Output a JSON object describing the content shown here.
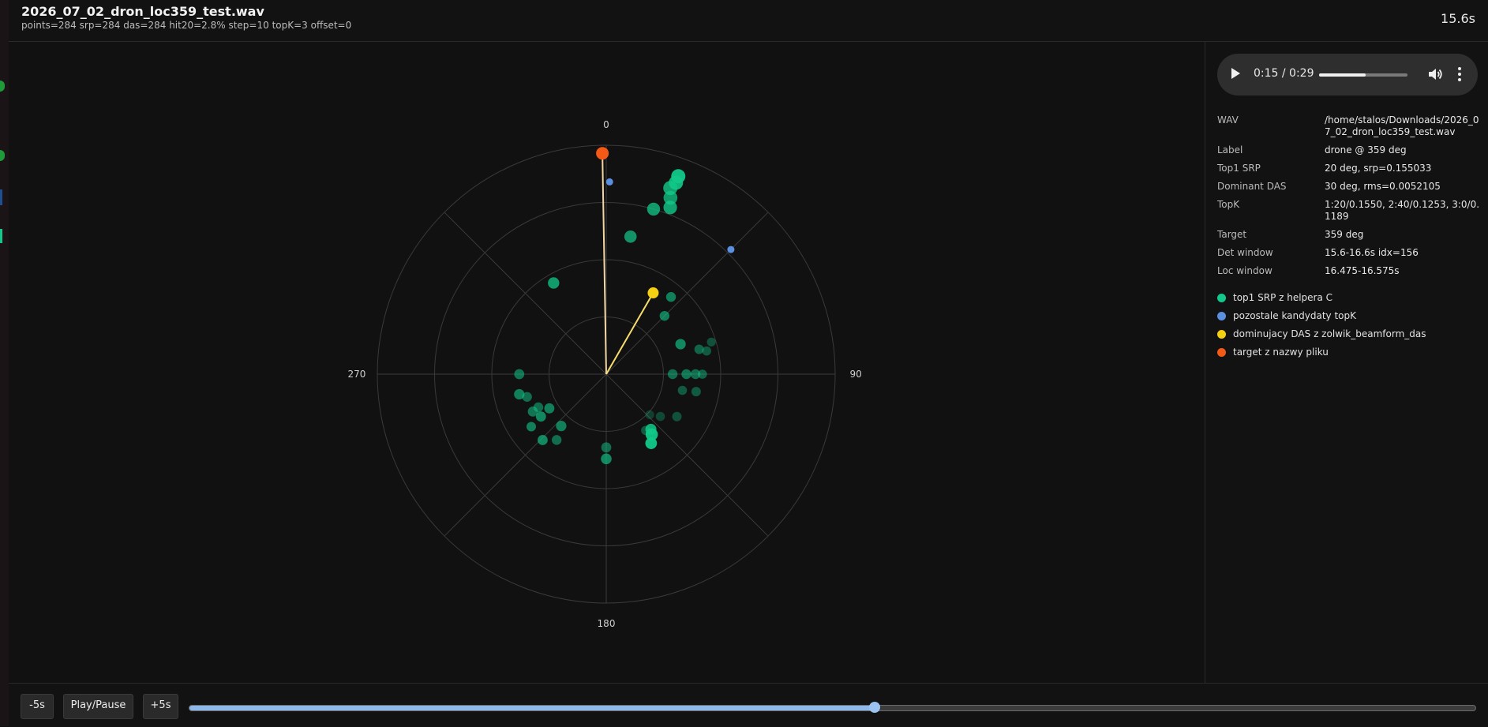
{
  "header": {
    "file_name": "2026_07_02_dron_loc359_test.wav",
    "stats": "points=284 srp=284 das=284 hit20=2.8% step=10 topK=3 offset=0",
    "time": "15.6s"
  },
  "audio": {
    "time": "0:15 / 0:29",
    "progress": 0.53
  },
  "info": [
    {
      "key": "WAV",
      "value": "/home/stalos/Downloads/2026_07_02_dron_loc359_test.wav"
    },
    {
      "key": "Label",
      "value": "drone @ 359 deg"
    },
    {
      "key": "Top1 SRP",
      "value": "20 deg, srp=0.155033"
    },
    {
      "key": "Dominant DAS",
      "value": "30 deg, rms=0.0052105"
    },
    {
      "key": "TopK",
      "value": "1:20/0.1550, 2:40/0.1253, 3:0/0.1189"
    },
    {
      "key": "Target",
      "value": "359 deg"
    },
    {
      "key": "Det window",
      "value": "15.6-16.6s idx=156"
    },
    {
      "key": "Loc window",
      "value": "16.475-16.575s"
    }
  ],
  "legend": [
    {
      "label": "top1 SRP z helpera C",
      "color": "#12c98a"
    },
    {
      "label": "pozostale kandydaty topK",
      "color": "#5b8fe0"
    },
    {
      "label": "dominujacy DAS z zolwik_beamform_das",
      "color": "#f5cf12"
    },
    {
      "label": "target z nazwy pliku",
      "color": "#f45a16"
    }
  ],
  "controls": {
    "back_label": "-5s",
    "play_label": "Play/Pause",
    "fwd_label": "+5s",
    "seek_fraction": 0.533
  },
  "polar": {
    "angle_labels": [
      "0",
      "90",
      "180",
      "270"
    ],
    "target_deg": 359,
    "das_deg": 30,
    "srp_points": [
      [
        20,
        0.92,
        1.0,
        0.95
      ],
      [
        20,
        0.89,
        1.0,
        0.9
      ],
      [
        19,
        0.86,
        1.0,
        0.8
      ],
      [
        20,
        0.82,
        0.95,
        0.75
      ],
      [
        21,
        0.78,
        0.9,
        0.8
      ],
      [
        16,
        0.75,
        0.8,
        0.75
      ],
      [
        10,
        0.61,
        0.7,
        0.7
      ],
      [
        -30,
        0.46,
        0.55,
        0.75
      ],
      [
        40,
        0.44,
        0.3,
        0.6
      ],
      [
        45,
        0.36,
        0.3,
        0.6
      ],
      [
        68,
        0.35,
        0.4,
        0.65
      ],
      [
        75,
        0.42,
        0.25,
        0.45
      ],
      [
        77,
        0.45,
        0.2,
        0.4
      ],
      [
        73,
        0.48,
        0.15,
        0.35
      ],
      [
        90,
        0.29,
        0.3,
        0.5
      ],
      [
        90,
        0.35,
        0.3,
        0.55
      ],
      [
        90,
        0.39,
        0.3,
        0.5
      ],
      [
        90,
        0.42,
        0.2,
        0.45
      ],
      [
        101,
        0.4,
        0.25,
        0.4
      ],
      [
        102,
        0.34,
        0.2,
        0.4
      ],
      [
        121,
        0.36,
        0.25,
        0.35
      ],
      [
        128,
        0.3,
        0.2,
        0.3
      ],
      [
        133,
        0.26,
        0.15,
        0.25
      ],
      [
        145,
        0.3,
        0.2,
        0.4
      ],
      [
        147,
        0.36,
        0.6,
        0.95
      ],
      [
        143,
        0.33,
        0.7,
        0.95
      ],
      [
        141,
        0.31,
        0.5,
        0.85
      ],
      [
        180,
        0.37,
        0.45,
        0.65
      ],
      [
        180,
        0.32,
        0.35,
        0.5
      ],
      [
        270,
        0.38,
        0.35,
        0.55
      ],
      [
        257,
        0.39,
        0.4,
        0.6
      ],
      [
        254,
        0.36,
        0.3,
        0.5
      ],
      [
        243,
        0.36,
        0.35,
        0.55
      ],
      [
        244,
        0.33,
        0.3,
        0.5
      ],
      [
        239,
        0.29,
        0.35,
        0.6
      ],
      [
        237,
        0.34,
        0.35,
        0.65
      ],
      [
        235,
        0.4,
        0.25,
        0.6
      ],
      [
        221,
        0.3,
        0.4,
        0.6
      ],
      [
        217,
        0.36,
        0.3,
        0.5
      ],
      [
        224,
        0.4,
        0.35,
        0.65
      ]
    ],
    "topk_points": [
      [
        1,
        0.84
      ],
      [
        45,
        0.77
      ]
    ]
  }
}
